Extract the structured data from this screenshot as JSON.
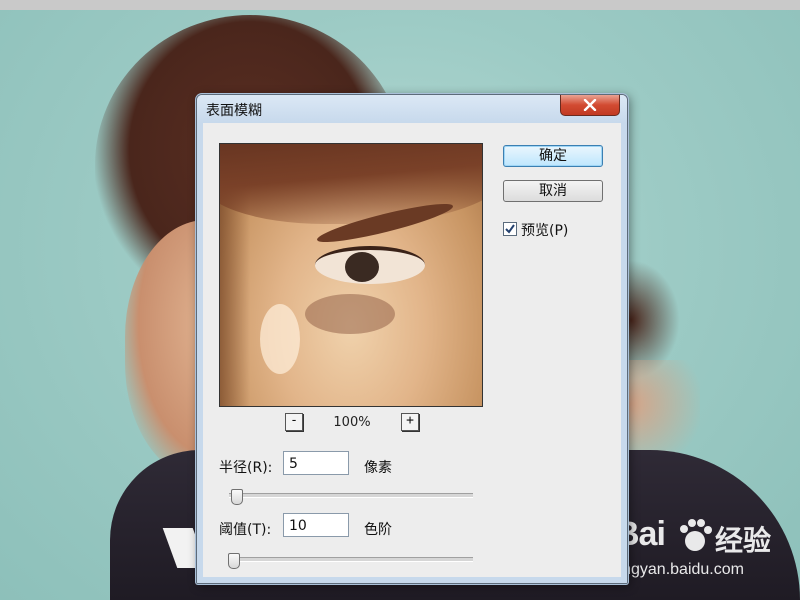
{
  "dialog": {
    "title": "表面模糊",
    "ok_label": "确定",
    "cancel_label": "取消",
    "preview_label": "预览(P)",
    "preview_checked": true,
    "zoom": {
      "minus_label": "-",
      "plus_label": "+",
      "level": "100%"
    },
    "radius": {
      "label": "半径(R):",
      "value": "5",
      "unit": "像素"
    },
    "threshold": {
      "label": "阈值(T):",
      "value": "10",
      "unit": "色阶"
    }
  },
  "watermark": {
    "logo_text": "Bai",
    "logo_cn": "经验",
    "url": "jingyan.baidu.com"
  },
  "icons": {
    "close": "close-icon",
    "check": "checkmark-icon",
    "paw": "baidu-paw-icon"
  },
  "colors": {
    "ok_button_border": "#3c7fb1",
    "close_button": "#d24b32",
    "titlebar": "#c7d9ec"
  }
}
